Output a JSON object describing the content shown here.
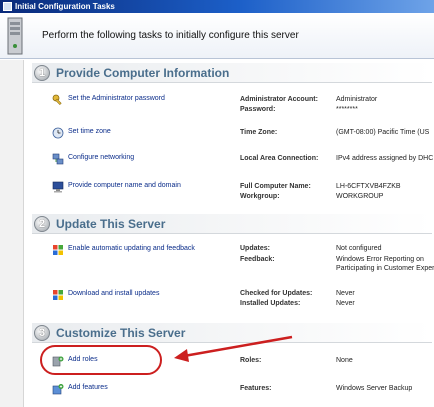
{
  "window": {
    "title": "Initial Configuration Tasks"
  },
  "banner": {
    "text": "Perform the following tasks to initially configure this server"
  },
  "sections": [
    {
      "number": "1",
      "title": "Provide Computer Information"
    },
    {
      "number": "2",
      "title": "Update This Server"
    },
    {
      "number": "3",
      "title": "Customize This Server"
    }
  ],
  "tasks": {
    "admin_password": "Set the Administrator password",
    "time_zone": "Set time zone",
    "networking": "Configure networking",
    "computer_name": "Provide computer name and domain",
    "auto_update": "Enable automatic updating and feedback",
    "download_updates": "Download and install updates",
    "add_roles": "Add roles",
    "add_features": "Add features"
  },
  "properties": {
    "admin_account_label": "Administrator Account:",
    "admin_account_value": "Administrator",
    "password_label": "Password:",
    "password_value": "********",
    "timezone_label": "Time Zone:",
    "timezone_value": "(GMT-08:00) Pacific Time (US",
    "lan_label": "Local Area Connection:",
    "lan_value": "IPv4 address assigned by DHC",
    "fullname_label": "Full Computer Name:",
    "fullname_value": "LH-6CFTXVB4FZKB",
    "workgroup_label": "Workgroup:",
    "workgroup_value": "WORKGROUP",
    "updates_label": "Updates:",
    "updates_value": "Not configured",
    "feedback_label": "Feedback:",
    "feedback_value_1": "Windows Error Reporting on",
    "feedback_value_2": "Participating in Customer Exper",
    "checked_label": "Checked for Updates:",
    "checked_value": "Never",
    "installed_label": "Installed Updates:",
    "installed_value": "Never",
    "roles_label": "Roles:",
    "roles_value": "None",
    "features_label": "Features:",
    "features_value": "Windows Server Backup"
  },
  "colors": {
    "link": "#0b2d8a",
    "section_title": "#4a6e8c",
    "highlight": "#cc1f1f",
    "titlebar": "#0a2a7a"
  }
}
